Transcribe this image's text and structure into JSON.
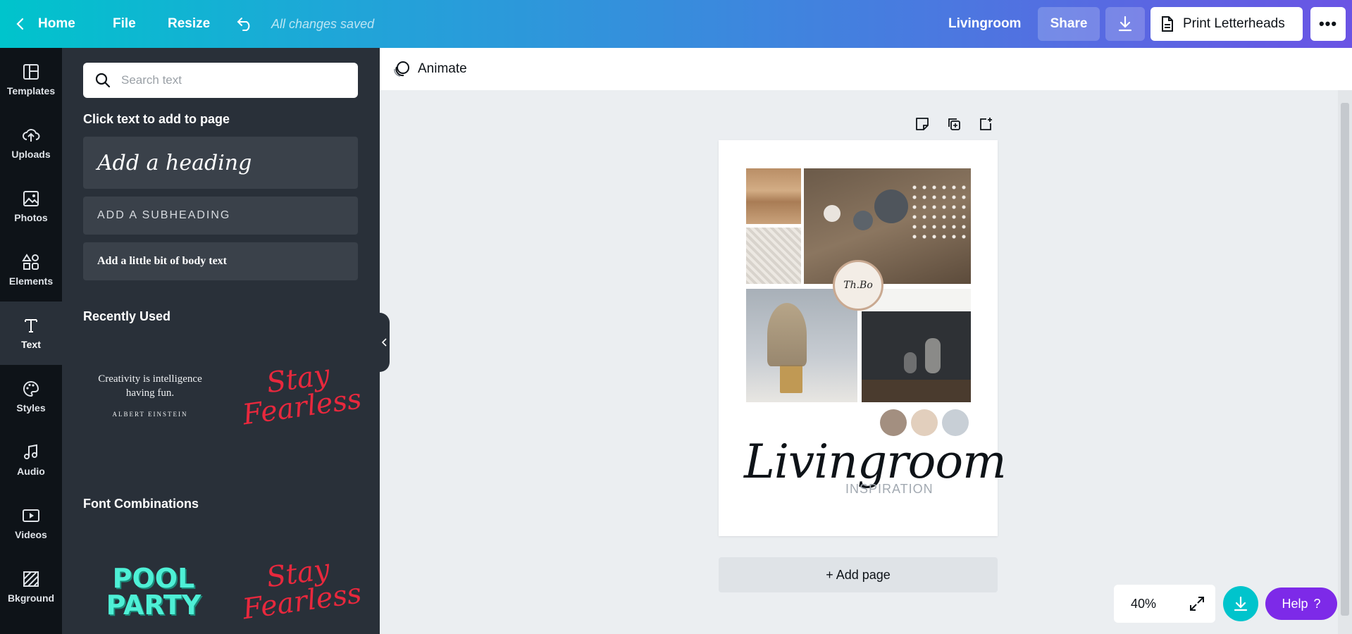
{
  "topbar": {
    "home": "Home",
    "file": "File",
    "resize": "Resize",
    "saved_status": "All changes saved",
    "design_name": "Livingroom",
    "share": "Share",
    "print": "Print Letterheads",
    "more": "•••"
  },
  "rail": {
    "items": [
      {
        "label": "Templates",
        "icon": "templates-icon"
      },
      {
        "label": "Uploads",
        "icon": "upload-icon"
      },
      {
        "label": "Photos",
        "icon": "photos-icon"
      },
      {
        "label": "Elements",
        "icon": "elements-icon"
      },
      {
        "label": "Text",
        "icon": "text-icon",
        "active": true
      },
      {
        "label": "Styles",
        "icon": "palette-icon"
      },
      {
        "label": "Audio",
        "icon": "music-icon"
      },
      {
        "label": "Videos",
        "icon": "video-icon"
      },
      {
        "label": "Bkground",
        "icon": "background-icon"
      }
    ]
  },
  "panel": {
    "search_placeholder": "Search text",
    "click_title": "Click text to add to page",
    "heading": "Add a heading",
    "subheading": "ADD A SUBHEADING",
    "body": "Add a little bit of body text",
    "recently_used": "Recently Used",
    "recent_quote": "Creativity is intelligence having fun.",
    "recent_author": "ALBERT EINSTEIN",
    "recent_script": "Stay Fearless",
    "font_combinations": "Font Combinations",
    "combo_pool_1": "POOL",
    "combo_pool_2": "PARTY",
    "combo_script": "Stay Fearless"
  },
  "animate": {
    "label": "Animate"
  },
  "canvas": {
    "title": "Livingroom",
    "subtitle": "INSPIRATION",
    "logo_text": "Th.Bo",
    "swatches": [
      "#a38f80",
      "#e2cfbd",
      "#c8cfd6"
    ],
    "add_page": "+ Add page"
  },
  "controls": {
    "zoom": "40%",
    "help": "Help",
    "help_mark": "?"
  },
  "colors": {
    "accent_teal": "#00c4cc",
    "accent_purple": "#7d2ae8",
    "panel_bg": "#293039",
    "rail_bg": "#0e1318"
  }
}
